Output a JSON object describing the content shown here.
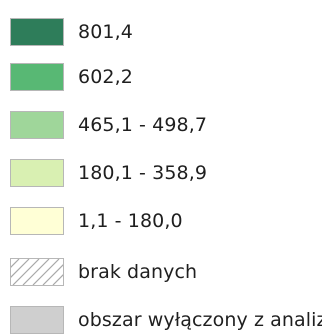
{
  "legend": {
    "items": [
      {
        "label": "801,4",
        "color": "#2E7D5A",
        "pattern": "solid"
      },
      {
        "label": "602,2",
        "color": "#58B874",
        "pattern": "solid"
      },
      {
        "label": "465,1 - 498,7",
        "color": "#9FD69A",
        "pattern": "solid"
      },
      {
        "label": "180,1 - 358,9",
        "color": "#D9F0B2",
        "pattern": "solid"
      },
      {
        "label": "1,1 - 180,0",
        "color": "#FFFFD6",
        "pattern": "solid"
      },
      {
        "label": "brak danych",
        "color": "#FFFFFF",
        "pattern": "diagonal-hatch"
      },
      {
        "label": "obszar wyłączony z analiz",
        "color": "#CFCFCF",
        "pattern": "solid"
      }
    ]
  }
}
